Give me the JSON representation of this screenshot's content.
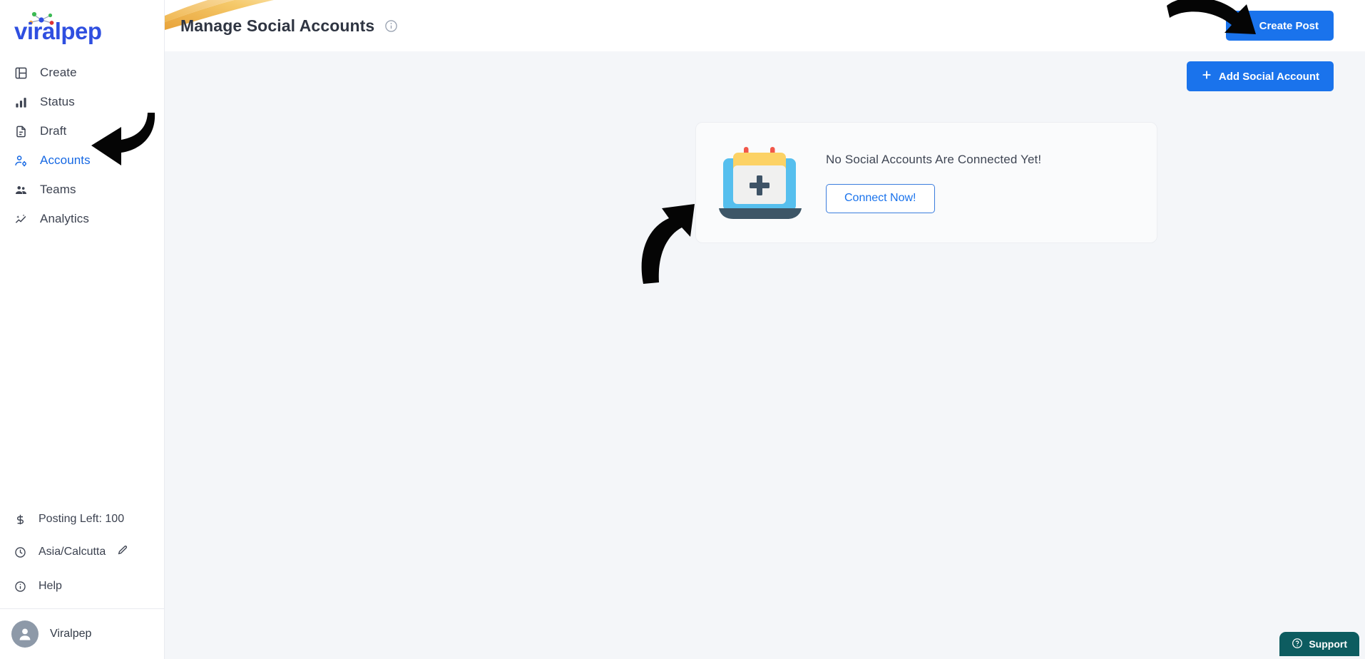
{
  "brand": {
    "logo_text": "viralpep",
    "logo_color": "#2f4fe0",
    "dot_colors": [
      "#3cba54",
      "#f4a23b",
      "#db3236",
      "#2f4fe0"
    ]
  },
  "sidebar": {
    "items": [
      {
        "label": "Create",
        "icon": "layout-icon",
        "active": false
      },
      {
        "label": "Status",
        "icon": "bar-chart-icon",
        "active": false
      },
      {
        "label": "Draft",
        "icon": "document-icon",
        "active": false
      },
      {
        "label": "Accounts",
        "icon": "user-settings-icon",
        "active": true
      },
      {
        "label": "Teams",
        "icon": "people-icon",
        "active": false
      },
      {
        "label": "Analytics",
        "icon": "sparkle-chart-icon",
        "active": false
      }
    ],
    "posting_left": "Posting Left: 100",
    "timezone": "Asia/Calcutta",
    "help": "Help",
    "user_name": "Viralpep",
    "active_color": "#1668e3"
  },
  "header": {
    "title": "Manage Social Accounts",
    "info_tooltip_icon": "info-circle-icon",
    "create_post_label": "Create Post"
  },
  "toolbar": {
    "add_social_account_label": "Add Social Account"
  },
  "empty_state": {
    "title": "No Social Accounts Are Connected Yet!",
    "cta_label": "Connect Now!",
    "illustration": "calendar-add-icon",
    "illustration_colors": {
      "screen": "#56bfee",
      "header_band": "#fcd265",
      "face": "#f0f0ef",
      "plus": "#3e5366",
      "base": "#3d5667",
      "pins": "#f1574a"
    }
  },
  "support": {
    "label": "Support",
    "icon": "question-circle-icon",
    "color": "#0d5c60"
  },
  "annotations": [
    {
      "name": "arrow-to-accounts",
      "direction": "left"
    },
    {
      "name": "arrow-to-create-post",
      "direction": "right"
    },
    {
      "name": "arrow-to-connect-now",
      "direction": "up-right"
    }
  ],
  "colors": {
    "primary": "#1a73ec",
    "page_bg": "#f4f6f9",
    "panel_bg": "#ffffff"
  }
}
